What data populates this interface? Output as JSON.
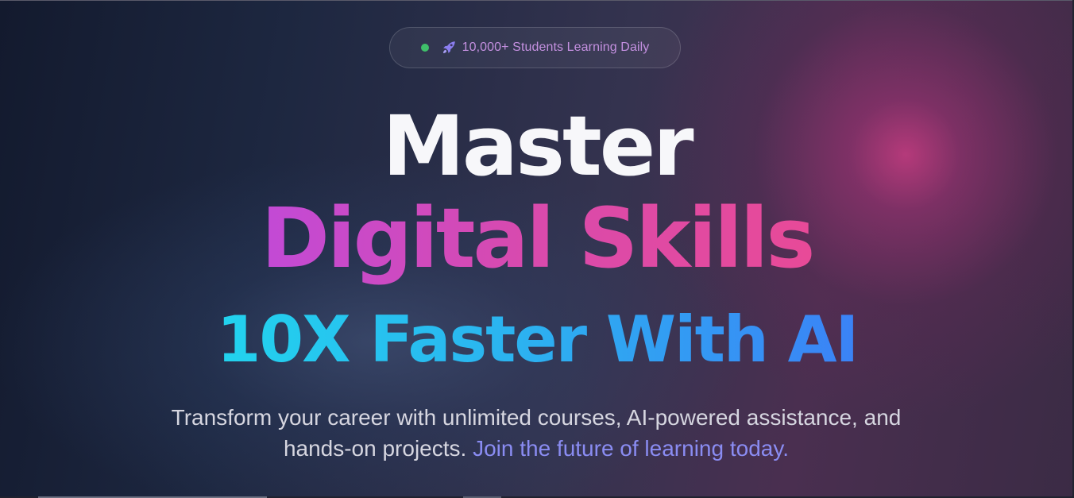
{
  "badge": {
    "dot_color": "#3fbf6a",
    "icon": "rocket-icon",
    "text": "10,000+ Students Learning Daily"
  },
  "hero": {
    "line1": "Master",
    "line2": "Digital Skills",
    "line3": "10X Faster With AI",
    "subtitle_main": "Transform your career with unlimited courses, AI-powered assistance, and hands-on projects.",
    "subtitle_highlight": "Join the future of learning today."
  },
  "colors": {
    "line1": "#f7f7fa",
    "line2_gradient": [
      "#c24ad6",
      "#e84a98"
    ],
    "line3_gradient": [
      "#22d3ee",
      "#3b82f6"
    ],
    "subtitle": "#d6d6e0",
    "highlight": "#8a8cf2",
    "badge_text": "#c490e0"
  }
}
